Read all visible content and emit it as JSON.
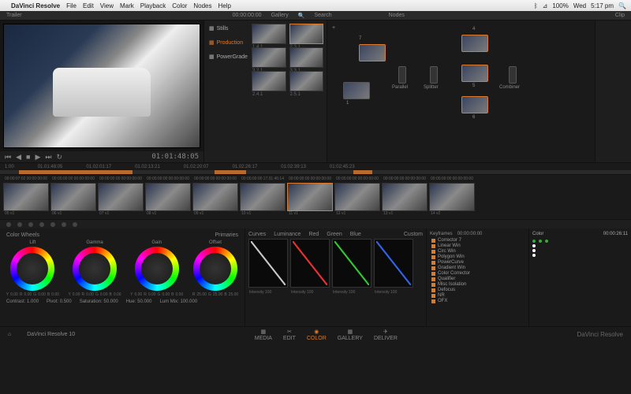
{
  "menubar": {
    "app": "DaVinci Resolve",
    "items": [
      "File",
      "Edit",
      "View",
      "Mark",
      "Playback",
      "Color",
      "Nodes",
      "Help"
    ],
    "battery": "100%",
    "day": "Wed",
    "time": "5:17 pm"
  },
  "toolbar": {
    "left": "Trailer",
    "tc": "00:00:00:00",
    "gallery": "Gallery",
    "search": "Search",
    "nodes": "Nodes",
    "clip": "Clip"
  },
  "gallery": {
    "cats": [
      "Stills",
      "Production",
      "PowerGrade"
    ],
    "thumbs": [
      "1.4.1",
      "2.3.1",
      "3.2.1",
      "3.3.1",
      "2.4.1",
      "2.5.1"
    ]
  },
  "nodes": {
    "items": [
      {
        "n": "7"
      },
      {
        "n": "1"
      },
      {
        "n": "Parallel"
      },
      {
        "n": "Splitter"
      },
      {
        "n": "4"
      },
      {
        "n": "5"
      },
      {
        "n": "6"
      },
      {
        "n": "Combiner"
      }
    ]
  },
  "viewer": {
    "tc": "01:01:48:05"
  },
  "timeline": {
    "marks": [
      "1:00",
      "01.01:48:05",
      "01.02:01:17",
      "01.02:13:21",
      "01.02:20:07",
      "01.02:26:17",
      "01:02:39:13",
      "01:02:45:23"
    ]
  },
  "clips": [
    {
      "a": "00:00:07:02",
      "b": "00:00:00:00",
      "id": "05",
      "tr": "v1"
    },
    {
      "a": "00:00:00:00",
      "b": "00:00:00:00",
      "id": "06",
      "tr": "v1"
    },
    {
      "a": "00:00:00:00",
      "b": "00:00:00:00",
      "id": "07",
      "tr": "v1"
    },
    {
      "a": "00:00:00:00",
      "b": "00:00:00:00",
      "id": "08",
      "tr": "v1"
    },
    {
      "a": "00:00:00:00",
      "b": "00:00:00:00",
      "id": "09",
      "tr": "v1"
    },
    {
      "a": "00:00:00:00",
      "b": "17:31:46:14",
      "id": "10",
      "tr": "v1"
    },
    {
      "a": "00:00:00:00",
      "b": "00:00:00:00",
      "id": "11",
      "tr": "v1"
    },
    {
      "a": "00:00:00:00",
      "b": "00:00:00:00",
      "id": "12",
      "tr": "v1"
    },
    {
      "a": "00:00:00:00",
      "b": "00:00:00:00",
      "id": "13",
      "tr": "v1"
    },
    {
      "a": "00:00:00:00",
      "b": "00:00:00:00",
      "id": "14",
      "tr": "v2"
    }
  ],
  "wheels": {
    "title": "Color Wheels",
    "primaries": "Primaries",
    "labels": [
      "Lift",
      "Gamma",
      "Gain",
      "Offset"
    ],
    "yrgb": "0.00",
    "offset": "25.00",
    "params": {
      "contrast": "Contrast: 1.000",
      "pivot": "Pivot: 0.500",
      "saturation": "Saturation: 50.000",
      "hue": "Hue: 50.000",
      "lum": "Lum Mix: 100.000"
    }
  },
  "curves": {
    "title": "Curves",
    "tabs": [
      "Luminance",
      "Red",
      "Green",
      "Blue"
    ],
    "custom": "Custom",
    "intensity": "Intensity 100"
  },
  "keyframes": {
    "title": "Keyframes",
    "tc1": "00:00:00:00",
    "tc2": "00:00:26:11",
    "items": [
      "Corrector 7",
      "Linear Win",
      "Circ Win",
      "Polygon Win",
      "PowerCurve",
      "Gradient Win",
      "Color Corrector",
      "Qualifier",
      "Misc Isolation",
      "Defocus",
      "NR",
      "OFX"
    ]
  },
  "colorpanel": {
    "title": "Color"
  },
  "footer": {
    "project": "DaVinci Resolve 10",
    "pages": [
      "MEDIA",
      "EDIT",
      "COLOR",
      "GALLERY",
      "DELIVER"
    ],
    "brand": "DaVinci Resolve"
  }
}
